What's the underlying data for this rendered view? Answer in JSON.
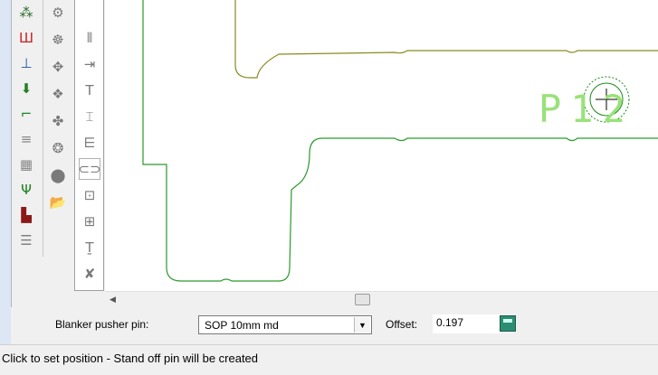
{
  "toolbar_left": [
    {
      "icon": "partial-top-icon",
      "glyph": "⁂",
      "color": "#2a6a2a"
    },
    {
      "icon": "red-rail-icon",
      "glyph": "Ш",
      "color": "#cc2020"
    },
    {
      "icon": "blue-tee-icon",
      "glyph": "⊥",
      "color": "#2050a0"
    },
    {
      "icon": "green-down-arrow-icon",
      "glyph": "⬇",
      "color": "#208020"
    },
    {
      "icon": "green-corner-icon",
      "glyph": "⌐",
      "color": "#208020"
    },
    {
      "icon": "list-icon",
      "glyph": "≡",
      "color": "#888888"
    },
    {
      "icon": "grid-icon",
      "glyph": "▦",
      "color": "#888888"
    },
    {
      "icon": "green-branch-icon",
      "glyph": "Ψ",
      "color": "#208020"
    },
    {
      "icon": "red-block-icon",
      "glyph": "▙",
      "color": "#8a1a1a"
    },
    {
      "icon": "gray-bars-icon",
      "glyph": "☰",
      "color": "#808080"
    }
  ],
  "toolbar_mid": [
    {
      "icon": "gray-shape-1-icon",
      "glyph": "⚙"
    },
    {
      "icon": "gray-shape-2-icon",
      "glyph": "☸"
    },
    {
      "icon": "gray-shape-3-icon",
      "glyph": "✥"
    },
    {
      "icon": "gray-shape-4-icon",
      "glyph": "❖"
    },
    {
      "icon": "gray-shape-5-icon",
      "glyph": "✤"
    },
    {
      "icon": "gray-shape-6-icon",
      "glyph": "❂"
    },
    {
      "icon": "gray-blob-icon",
      "glyph": "⬤"
    },
    {
      "icon": "folder-open-icon",
      "glyph": "📂"
    }
  ],
  "toolbar_right": [
    {
      "icon": "pusher-pin-icon",
      "glyph": "⫴"
    },
    {
      "icon": "pin-arrow-icon",
      "glyph": "⇥"
    },
    {
      "icon": "text-tool-icon",
      "glyph": "T"
    },
    {
      "icon": "frame-icon",
      "glyph": "⌶"
    },
    {
      "icon": "stack-icon",
      "glyph": "⋿"
    },
    {
      "icon": "standoff-pin-icon",
      "glyph": "⊂⊃",
      "selected": true
    },
    {
      "icon": "label-box-icon",
      "glyph": "⊡"
    },
    {
      "icon": "number-box-icon",
      "glyph": "⊞"
    },
    {
      "icon": "text-t-icon",
      "glyph": "Ṯ"
    },
    {
      "icon": "delete-pin-icon",
      "glyph": "✘"
    }
  ],
  "canvas": {
    "pin_label": "P12",
    "part_outline_color": "#2a9a2a",
    "top_outline_color": "#8a8a20",
    "text_color": "#99e27a",
    "hole_color": "#1a8a1a"
  },
  "options": {
    "pin_label": "Blanker pusher pin:",
    "pin_value": "SOP 10mm md",
    "offset_label": "Offset:",
    "offset_value": "0.197"
  },
  "status": {
    "text": "Click to set position - Stand off pin will be created"
  }
}
